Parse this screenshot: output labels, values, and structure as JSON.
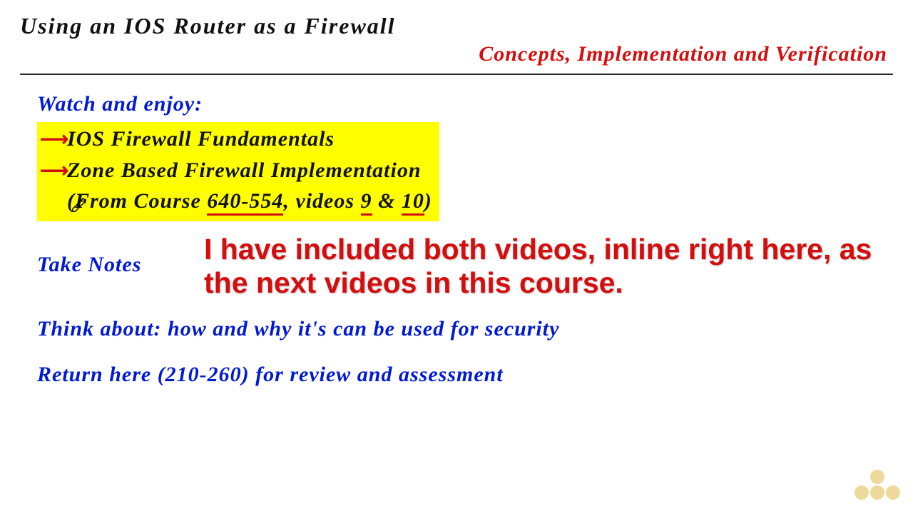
{
  "header": {
    "title": "Using an IOS Router as a Firewall",
    "subtitle": "Concepts, Implementation and Verification"
  },
  "watch": {
    "heading": "Watch and enjoy:",
    "items": [
      "IOS Firewall Fundamentals",
      "Zone Based Firewall Implementation"
    ],
    "source_prefix": "(From Course ",
    "course_code": "640-554",
    "source_mid": ", videos ",
    "video_a": "9",
    "source_amp": " & ",
    "video_b": "10",
    "source_suffix": ")"
  },
  "take_notes": "Take Notes",
  "instructor_note": "I have included both videos, inline right here, as the next videos in this course.",
  "think_about": "Think about: how and why it's can be used for security",
  "return_here": "Return here (210-260) for review and assessment"
}
